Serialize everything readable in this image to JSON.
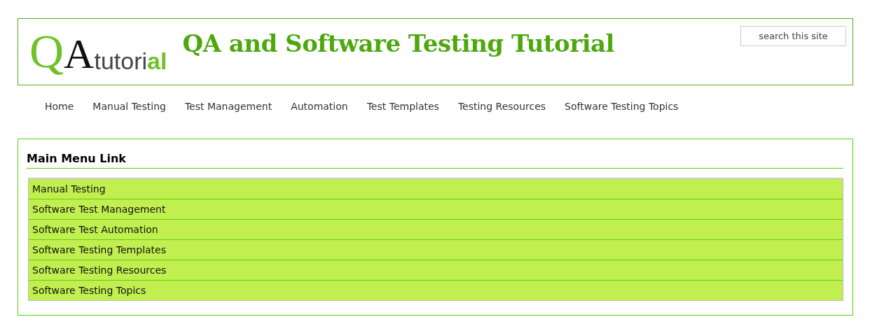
{
  "header": {
    "logo": [
      {
        "text": "Q",
        "kind": "big-green"
      },
      {
        "text": "A",
        "kind": "big-dark"
      },
      {
        "text": "tutori",
        "kind": "plain"
      },
      {
        "text": "al",
        "kind": "accent"
      }
    ],
    "title": "QA and Software Testing Tutorial",
    "search": {
      "placeholder": "search this site"
    }
  },
  "nav": [
    "Home",
    "Manual Testing",
    "Test Management",
    "Automation",
    "Test Templates",
    "Testing Resources",
    "Software Testing Topics"
  ],
  "menu": {
    "title": "Main Menu Link",
    "items": [
      "Manual Testing",
      "Software Test Management",
      "Software Test Automation",
      "Software Testing Templates",
      "Software Testing Resources",
      "Software Testing Topics"
    ]
  }
}
